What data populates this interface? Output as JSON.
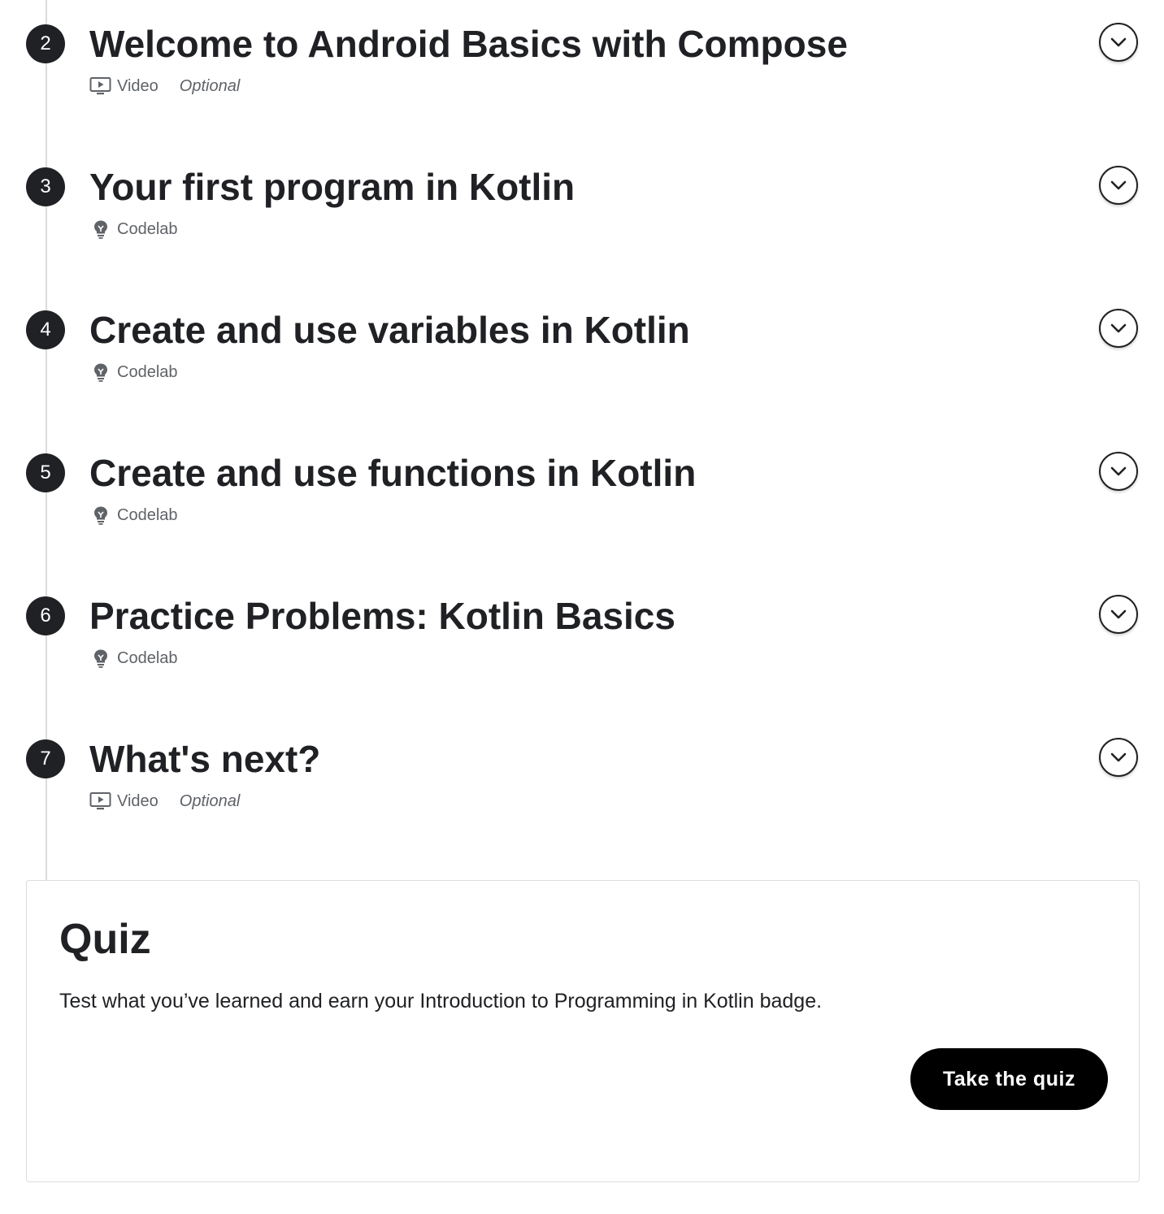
{
  "steps": [
    {
      "number": "2",
      "title": "Welcome to Android Basics with Compose",
      "type": "Video",
      "icon": "video-icon",
      "optional": "Optional"
    },
    {
      "number": "3",
      "title": "Your first program in Kotlin",
      "type": "Codelab",
      "icon": "codelab-lightbulb-icon"
    },
    {
      "number": "4",
      "title": "Create and use variables in Kotlin",
      "type": "Codelab",
      "icon": "codelab-lightbulb-icon"
    },
    {
      "number": "5",
      "title": "Create and use functions in Kotlin",
      "type": "Codelab",
      "icon": "codelab-lightbulb-icon"
    },
    {
      "number": "6",
      "title": "Practice Problems: Kotlin Basics",
      "type": "Codelab",
      "icon": "codelab-lightbulb-icon"
    },
    {
      "number": "7",
      "title": "What's next?",
      "type": "Video",
      "icon": "video-icon",
      "optional": "Optional"
    }
  ],
  "quiz": {
    "title": "Quiz",
    "description": "Test what you’ve learned and earn your Introduction to Programming in Kotlin badge.",
    "button_label": "Take the quiz"
  },
  "colors": {
    "text": "#202124",
    "meta_text": "#5f6368",
    "timeline": "#dadce0",
    "button_bg": "#000000"
  }
}
